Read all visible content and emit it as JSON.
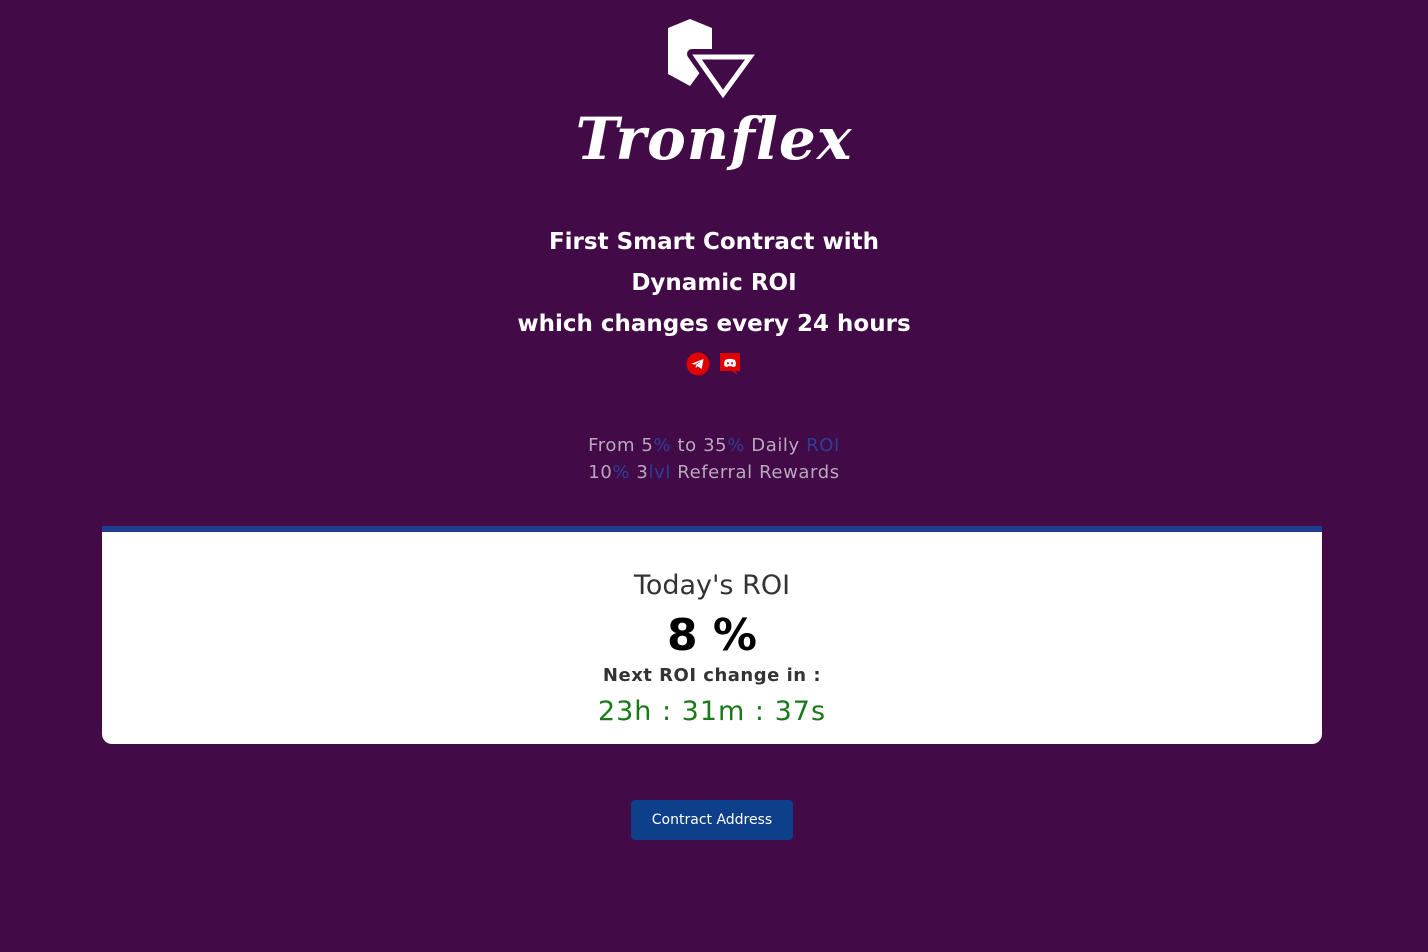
{
  "brand": {
    "name": "Tronflex",
    "logo_icon": "tronflex-logo-icon"
  },
  "headline": {
    "line1": "First Smart Contract with",
    "line2": "Dynamic ROI",
    "line3": "which changes every 24 hours"
  },
  "socials": [
    {
      "icon": "telegram-icon",
      "color": "#e00000"
    },
    {
      "icon": "discord-icon",
      "color": "#e00000"
    }
  ],
  "features": {
    "line1": {
      "from": "From 5",
      "pct1": "%",
      "to": " to 35",
      "pct2": "%",
      "daily": " Daily ",
      "roi": "ROI"
    },
    "line2": {
      "ten": "10",
      "pct": "%",
      "three": " 3",
      "lvl": "lvl",
      "rest": " Referral Rewards"
    }
  },
  "roi_card": {
    "title": "Today's ROI",
    "value": "8 %",
    "next_label": "Next ROI change in :",
    "countdown": "23h : 31m : 37s"
  },
  "contract_button": {
    "label": "Contract Address"
  },
  "colors": {
    "background": "#420a47",
    "accent": "#1d3e8f",
    "button": "#0d3f8a",
    "timer": "#177a17",
    "social": "#e00000"
  }
}
